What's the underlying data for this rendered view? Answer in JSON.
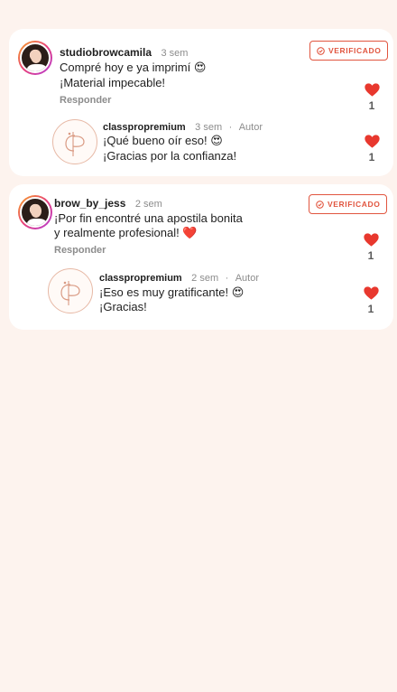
{
  "comments": [
    {
      "username": "studiobrowcamila",
      "time": "3 sem",
      "line1": "Compré hoy e ya imprimí",
      "line1_emoji": "😍",
      "line2": "¡Material impecable!",
      "line2_emoji": "",
      "reply_label": "Responder",
      "badge": "VERIFICADO",
      "likes": "1",
      "reply": {
        "username": "classpropremium",
        "time": "3 sem",
        "role": "Autor",
        "line1": "¡Qué bueno oír eso!",
        "line1_emoji": "😍",
        "line2": "¡Gracias por la confianza!",
        "likes": "1"
      }
    },
    {
      "username": "brow_by_jess",
      "time": "2 sem",
      "line1": "¡Por fin encontré una apostila bonita",
      "line1_emoji": "",
      "line2": "y realmente profesional!",
      "line2_emoji": "❤️",
      "reply_label": "Responder",
      "badge": "VERIFICADO",
      "likes": "1",
      "reply": {
        "username": "classpropremium",
        "time": "2 sem",
        "role": "Autor",
        "line1": "¡Eso es muy gratificante!",
        "line1_emoji": "😍",
        "line2": "¡Gracias!",
        "likes": "1"
      }
    }
  ],
  "separator": "·",
  "colors": {
    "accent": "#e1553f",
    "heart": "#e8382e",
    "background": "#fdf3ee"
  }
}
